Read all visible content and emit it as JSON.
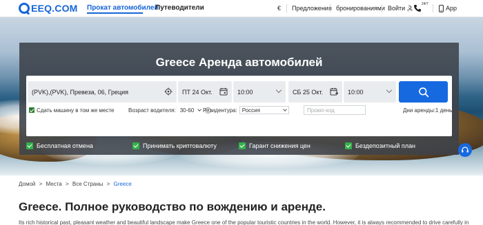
{
  "header": {
    "logo_text": "EEQ.COM",
    "nav": {
      "car_rental": "Прокат автомобилей",
      "guides": "Путеводители"
    },
    "currency": "€",
    "offers": "Предложения",
    "bookings": "бронированиями",
    "login": "Войти",
    "support_badge": "24/7",
    "app": "App"
  },
  "hero": {
    "title": "Greece Аренда автомобилей",
    "location_value": "(PVK),(PVK), Превеза, 06, Греция",
    "pickup_date": "ПТ 24 Окт.",
    "pickup_time": "10:00",
    "return_date": "СБ 25 Окт.",
    "return_time": "10:00",
    "return_same_label": "Сдать машину в том же месте",
    "driver_age_label": "Возраст водителя:",
    "driver_age_value": "30-60",
    "residency_label": "Резидентура:",
    "residency_value": "Россия",
    "promo_placeholder": "Промо-код",
    "rental_days": "Дни аренды:1 день",
    "features": [
      "Бесплатная отмена",
      "Принимать криптовалюту",
      "Гарант снижения цен",
      "Бездепозитный план"
    ]
  },
  "breadcrumb": {
    "home": "Домой",
    "places": "Места",
    "countries": "Все Страны",
    "current": "Greece",
    "sep": ">"
  },
  "content": {
    "heading": "Greece. Полное руководство по вождению и аренде.",
    "intro": "Its rich historical past, pleasant weather and beautiful landscape make Greece one of the popular touristic countries in the world. However, it is always recommended to drive carefully in"
  },
  "colors": {
    "brand": "#1565d8",
    "search_button": "#1769e0",
    "feature_check": "#33b24a",
    "panel": "#3c424a"
  }
}
